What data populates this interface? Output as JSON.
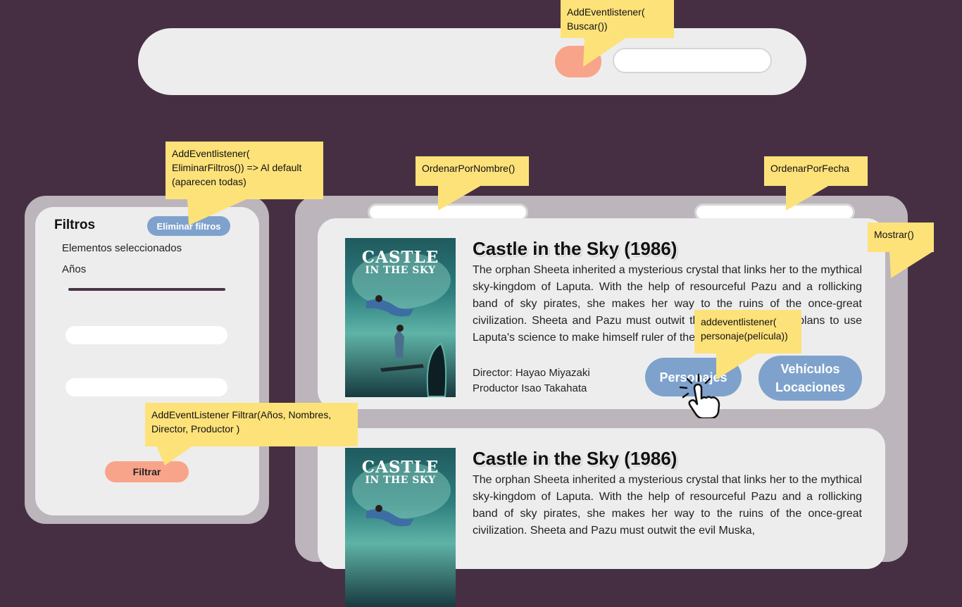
{
  "filters": {
    "title": "Filtros",
    "clear_label": "Eliminar filtros",
    "selected_label": "Elementos seleccionados",
    "years_label": "Años",
    "filter_button_label": "Filtrar"
  },
  "cards": [
    {
      "title": "Castle in the Sky (1986)",
      "poster_line1": "CASTLE",
      "poster_line2": "IN THE SKY",
      "description": "The orphan Sheeta inherited a mysterious crystal that links her to the mythical sky-kingdom of Laputa. With the help of resourceful Pazu and a rollicking band of sky pirates, she makes her way to the ruins of the once-great civilization. Sheeta and Pazu must outwit the evil Muska, who plans to use Laputa's science to make himself ruler of the world.",
      "director": "Director: Hayao Miyazaki",
      "producer": "Productor Isao Takahata",
      "characters_label": "Personajes",
      "vehicles_label": "Vehículos",
      "locations_label": "Locaciones"
    },
    {
      "title": "Castle in the Sky (1986)",
      "poster_line1": "CASTLE",
      "poster_line2": "IN THE SKY",
      "description": "The orphan Sheeta inherited a mysterious crystal that links her to the mythical sky-kingdom of Laputa. With the help of resourceful Pazu and a rollicking band of sky pirates, she makes her way to the ruins of the once-great civilization. Sheeta and Pazu must outwit the evil Muska,"
    }
  ],
  "notes": {
    "search": "AddEventlistener( Buscar())",
    "clear": "AddEventlistener( EliminarFiltros()) => Al default (aparecen todas)",
    "sort_name": "OrdenarPorNombre()",
    "sort_date": "OrdenarPorFecha",
    "show": "Mostrar()",
    "characters": "addeventlistener( personaje(película))",
    "filter": "AddEventListener Filtrar(Años, Nombres, Director, Productor )"
  },
  "colors": {
    "background": "#472f43",
    "panel": "#bcb5bb",
    "card": "#ededed",
    "accent_blue": "#7fa2cd",
    "accent_salmon": "#f8a48a",
    "note": "#fde27a"
  },
  "icons": [
    "hand-pointer-icon"
  ]
}
